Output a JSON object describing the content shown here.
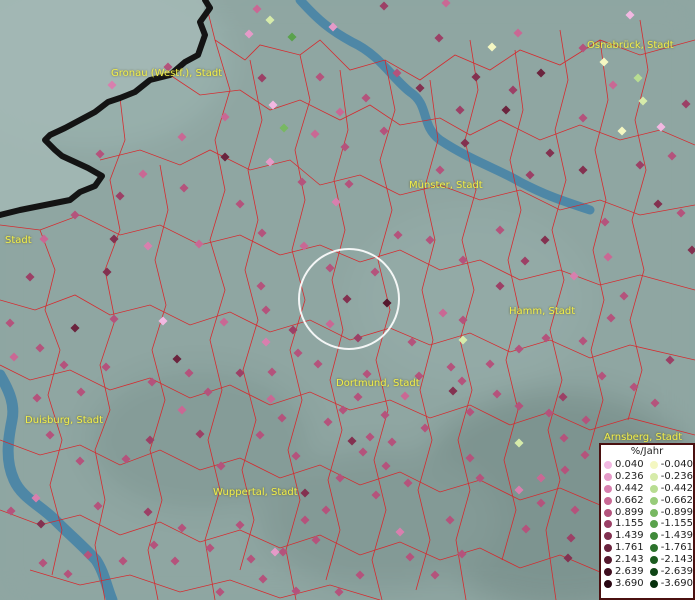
{
  "map": {
    "colors": {
      "land": "#8fa6a2",
      "water": "#3d7fa8",
      "boundary": "#d8262a",
      "border": "#141414",
      "label": "#f2ef4a"
    },
    "cities": [
      {
        "name": "Gronau (Westf.), Stadt",
        "id": "gronau"
      },
      {
        "name": "Osnabrück, Stadt",
        "id": "osnabrueck"
      },
      {
        "name": "Münster, Stadt",
        "id": "muenster"
      },
      {
        "name": "Stadt",
        "id": "partial-west"
      },
      {
        "name": "Hamm, Stadt",
        "id": "hamm"
      },
      {
        "name": "Dortmund, Stadt",
        "id": "dortmund"
      },
      {
        "name": "Duisburg, Stadt",
        "id": "duisburg"
      },
      {
        "name": "Arnsberg, Stadt",
        "id": "arnsberg"
      },
      {
        "name": "Wuppertal, Stadt",
        "id": "wuppertal"
      }
    ],
    "stations": [
      [
        257,
        9,
        3
      ],
      [
        270,
        20,
        -2
      ],
      [
        292,
        37,
        -6
      ],
      [
        249,
        34,
        1
      ],
      [
        333,
        27,
        1
      ],
      [
        384,
        6,
        5
      ],
      [
        439,
        38,
        5
      ],
      [
        446,
        3,
        3
      ],
      [
        492,
        47,
        -1
      ],
      [
        518,
        33,
        3
      ],
      [
        583,
        48,
        4
      ],
      [
        604,
        62,
        -1
      ],
      [
        630,
        15,
        0
      ],
      [
        638,
        78,
        -3
      ],
      [
        643,
        101,
        -2
      ],
      [
        661,
        127,
        0
      ],
      [
        613,
        85,
        3
      ],
      [
        686,
        104,
        5
      ],
      [
        622,
        131,
        -1
      ],
      [
        284,
        128,
        -5
      ],
      [
        262,
        78,
        5
      ],
      [
        320,
        77,
        4
      ],
      [
        273,
        105,
        0
      ],
      [
        225,
        117,
        3
      ],
      [
        182,
        137,
        3
      ],
      [
        168,
        67,
        4
      ],
      [
        112,
        85,
        2
      ],
      [
        100,
        154,
        4
      ],
      [
        143,
        174,
        3
      ],
      [
        120,
        196,
        5
      ],
      [
        225,
        157,
        7
      ],
      [
        270,
        162,
        1
      ],
      [
        315,
        134,
        3
      ],
      [
        345,
        147,
        4
      ],
      [
        340,
        112,
        3
      ],
      [
        366,
        98,
        4
      ],
      [
        384,
        131,
        4
      ],
      [
        397,
        73,
        4
      ],
      [
        420,
        88,
        6
      ],
      [
        440,
        170,
        4
      ],
      [
        465,
        143,
        6
      ],
      [
        460,
        110,
        5
      ],
      [
        506,
        110,
        7
      ],
      [
        476,
        77,
        6
      ],
      [
        541,
        73,
        7
      ],
      [
        550,
        153,
        6
      ],
      [
        513,
        90,
        5
      ],
      [
        530,
        175,
        5
      ],
      [
        583,
        170,
        6
      ],
      [
        583,
        118,
        4
      ],
      [
        640,
        165,
        5
      ],
      [
        672,
        156,
        4
      ],
      [
        658,
        204,
        6
      ],
      [
        681,
        213,
        4
      ],
      [
        692,
        250,
        6
      ],
      [
        605,
        222,
        4
      ],
      [
        608,
        257,
        3
      ],
      [
        574,
        276,
        2
      ],
      [
        545,
        240,
        6
      ],
      [
        500,
        230,
        4
      ],
      [
        525,
        261,
        5
      ],
      [
        500,
        286,
        5
      ],
      [
        463,
        260,
        4
      ],
      [
        430,
        240,
        4
      ],
      [
        398,
        235,
        4
      ],
      [
        375,
        272,
        4
      ],
      [
        336,
        202,
        2
      ],
      [
        304,
        246,
        3
      ],
      [
        349,
        184,
        4
      ],
      [
        302,
        182,
        4
      ],
      [
        262,
        233,
        4
      ],
      [
        240,
        204,
        4
      ],
      [
        184,
        188,
        4
      ],
      [
        199,
        244,
        3
      ],
      [
        148,
        246,
        2
      ],
      [
        114,
        239,
        6
      ],
      [
        107,
        272,
        6
      ],
      [
        75,
        215,
        4
      ],
      [
        44,
        239,
        3
      ],
      [
        30,
        277,
        5
      ],
      [
        10,
        323,
        4
      ],
      [
        14,
        357,
        3
      ],
      [
        40,
        348,
        4
      ],
      [
        75,
        328,
        7
      ],
      [
        114,
        319,
        4
      ],
      [
        163,
        321,
        0
      ],
      [
        177,
        359,
        7
      ],
      [
        189,
        373,
        4
      ],
      [
        152,
        382,
        4
      ],
      [
        106,
        367,
        4
      ],
      [
        81,
        392,
        4
      ],
      [
        64,
        365,
        4
      ],
      [
        37,
        398,
        4
      ],
      [
        50,
        435,
        4
      ],
      [
        36,
        498,
        2
      ],
      [
        41,
        524,
        6
      ],
      [
        11,
        511,
        4
      ],
      [
        80,
        461,
        4
      ],
      [
        98,
        506,
        4
      ],
      [
        126,
        459,
        4
      ],
      [
        150,
        440,
        5
      ],
      [
        148,
        512,
        5
      ],
      [
        182,
        410,
        3
      ],
      [
        224,
        322,
        3
      ],
      [
        266,
        342,
        2
      ],
      [
        293,
        330,
        5
      ],
      [
        330,
        324,
        3
      ],
      [
        347,
        299,
        6
      ],
      [
        358,
        338,
        5
      ],
      [
        387,
        303,
        8
      ],
      [
        330,
        268,
        4
      ],
      [
        261,
        286,
        4
      ],
      [
        240,
        373,
        5
      ],
      [
        272,
        372,
        4
      ],
      [
        266,
        310,
        4
      ],
      [
        298,
        353,
        4
      ],
      [
        318,
        364,
        4
      ],
      [
        367,
        374,
        4
      ],
      [
        343,
        410,
        4
      ],
      [
        271,
        399,
        3
      ],
      [
        208,
        392,
        4
      ],
      [
        200,
        434,
        5
      ],
      [
        221,
        466,
        4
      ],
      [
        240,
        525,
        4
      ],
      [
        260,
        435,
        4
      ],
      [
        296,
        456,
        4
      ],
      [
        305,
        493,
        6
      ],
      [
        282,
        418,
        4
      ],
      [
        328,
        422,
        4
      ],
      [
        358,
        397,
        4
      ],
      [
        385,
        415,
        4
      ],
      [
        405,
        396,
        3
      ],
      [
        419,
        376,
        4
      ],
      [
        462,
        381,
        4
      ],
      [
        451,
        367,
        4
      ],
      [
        412,
        342,
        4
      ],
      [
        443,
        313,
        3
      ],
      [
        463,
        320,
        4
      ],
      [
        463,
        340,
        -2
      ],
      [
        490,
        364,
        4
      ],
      [
        519,
        349,
        4
      ],
      [
        546,
        338,
        4
      ],
      [
        583,
        341,
        4
      ],
      [
        611,
        318,
        4
      ],
      [
        624,
        296,
        4
      ],
      [
        670,
        360,
        5
      ],
      [
        655,
        403,
        4
      ],
      [
        634,
        387,
        4
      ],
      [
        602,
        376,
        4
      ],
      [
        563,
        397,
        5
      ],
      [
        549,
        413,
        4
      ],
      [
        519,
        406,
        4
      ],
      [
        497,
        394,
        4
      ],
      [
        470,
        412,
        4
      ],
      [
        453,
        391,
        6
      ],
      [
        425,
        428,
        4
      ],
      [
        386,
        466,
        4
      ],
      [
        363,
        452,
        4
      ],
      [
        352,
        441,
        6
      ],
      [
        370,
        437,
        4
      ],
      [
        392,
        442,
        4
      ],
      [
        408,
        483,
        4
      ],
      [
        376,
        495,
        4
      ],
      [
        340,
        478,
        4
      ],
      [
        326,
        510,
        4
      ],
      [
        305,
        520,
        4
      ],
      [
        316,
        540,
        4
      ],
      [
        283,
        552,
        4
      ],
      [
        275,
        552,
        1
      ],
      [
        251,
        559,
        4
      ],
      [
        210,
        548,
        4
      ],
      [
        175,
        561,
        4
      ],
      [
        182,
        528,
        4
      ],
      [
        154,
        545,
        4
      ],
      [
        123,
        561,
        4
      ],
      [
        88,
        555,
        4
      ],
      [
        68,
        574,
        4
      ],
      [
        43,
        563,
        4
      ],
      [
        470,
        458,
        4
      ],
      [
        480,
        478,
        4
      ],
      [
        519,
        490,
        2
      ],
      [
        541,
        478,
        3
      ],
      [
        519,
        443,
        -2
      ],
      [
        541,
        503,
        4
      ],
      [
        575,
        510,
        4
      ],
      [
        571,
        538,
        5
      ],
      [
        568,
        558,
        6
      ],
      [
        526,
        529,
        4
      ],
      [
        462,
        554,
        4
      ],
      [
        450,
        520,
        4
      ],
      [
        435,
        575,
        4
      ],
      [
        410,
        557,
        4
      ],
      [
        400,
        532,
        2
      ],
      [
        360,
        575,
        4
      ],
      [
        339,
        592,
        4
      ],
      [
        296,
        591,
        4
      ],
      [
        263,
        579,
        4
      ],
      [
        220,
        592,
        4
      ],
      [
        586,
        420,
        4
      ],
      [
        564,
        438,
        4
      ],
      [
        585,
        455,
        4
      ],
      [
        565,
        470,
        4
      ]
    ]
  },
  "legend": {
    "title": "%/Jahr",
    "positive": [
      {
        "label": "0.040",
        "color": "#f2b8e2"
      },
      {
        "label": "0.236",
        "color": "#e59ac8"
      },
      {
        "label": "0.442",
        "color": "#d87fae"
      },
      {
        "label": "0.662",
        "color": "#c96894"
      },
      {
        "label": "0.899",
        "color": "#b4537c"
      },
      {
        "label": "1.155",
        "color": "#9c4066"
      },
      {
        "label": "1.439",
        "color": "#833150"
      },
      {
        "label": "1.761",
        "color": "#6b243e"
      },
      {
        "label": "2.143",
        "color": "#55182d"
      },
      {
        "label": "2.639",
        "color": "#400e1f"
      },
      {
        "label": "3.690",
        "color": "#2a0612"
      }
    ],
    "negative": [
      {
        "label": "-0.040",
        "color": "#f4f7c2"
      },
      {
        "label": "-0.236",
        "color": "#d6ebaa"
      },
      {
        "label": "-0.442",
        "color": "#b8dd92"
      },
      {
        "label": "-0.662",
        "color": "#98cc7a"
      },
      {
        "label": "-0.899",
        "color": "#78b862"
      },
      {
        "label": "-1.155",
        "color": "#5aa24c"
      },
      {
        "label": "-1.439",
        "color": "#408a3a"
      },
      {
        "label": "-1.761",
        "color": "#2c722c"
      },
      {
        "label": "-2.143",
        "color": "#1c5c20"
      },
      {
        "label": "-2.639",
        "color": "#104616"
      },
      {
        "label": "-3.690",
        "color": "#06300c"
      }
    ]
  }
}
